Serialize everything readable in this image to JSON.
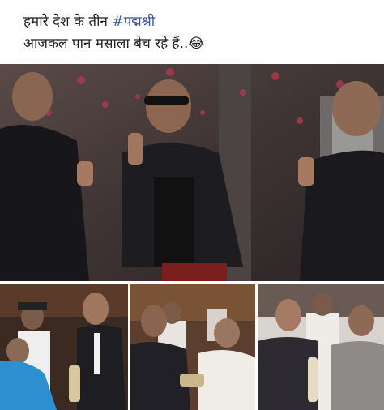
{
  "post": {
    "line1_prefix": "हमारे देश के तीन ",
    "hashtag": "#पद्मश्री",
    "line2": "आजकल पान मसाला बेच रहे हैं..😂"
  },
  "images": {
    "main": "three-men-gesturing-photo",
    "award_1": "award-ceremony-photo-1",
    "award_2": "award-ceremony-photo-2",
    "award_3": "award-ceremony-photo-3"
  },
  "colors": {
    "text": "#1c1e21",
    "hashtag": "#385898",
    "background": "#ffffff"
  }
}
